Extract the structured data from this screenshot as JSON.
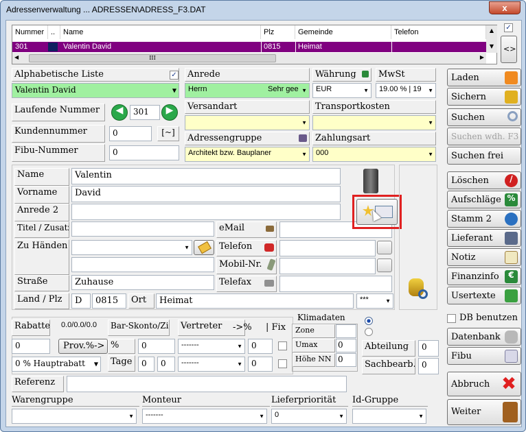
{
  "window": {
    "title": "Adressenverwaltung ... ADRESSEN\\ADRESS_F3.DAT",
    "close": "x"
  },
  "grid": {
    "headers": {
      "nummer": "Nummer",
      "dots": "..",
      "name": "Name",
      "plz": "Plz",
      "gemeinde": "Gemeinde",
      "telefon": "Telefon"
    },
    "row": {
      "nummer": "301",
      "name": "Valentin David",
      "plz": "0815",
      "gemeinde": "Heimat"
    },
    "hthumb": "III"
  },
  "nav": "<>",
  "alpha": {
    "label": "Alphabetische Liste",
    "value": "Valentin David",
    "checked": "✓"
  },
  "anrede": {
    "label": "Anrede",
    "value": "Herrn",
    "value2": "Sehr gee"
  },
  "waehrung": {
    "label": "Währung",
    "value": "EUR"
  },
  "mwst": {
    "label": "MwSt",
    "value": "19.00 % | 19"
  },
  "laufende": {
    "label": "Laufende Nummer",
    "value": "301"
  },
  "versandart": {
    "label": "Versandart"
  },
  "transport": {
    "label": "Transportkosten"
  },
  "kundennummer": {
    "label": "Kundennummer",
    "value": "0",
    "btn": "[~]"
  },
  "adressgruppe": {
    "label": "Adressengruppe",
    "value": "Architekt bzw. Bauplaner"
  },
  "zahlungsart": {
    "label": "Zahlungsart",
    "value": "000"
  },
  "fibu_nr": {
    "label": "Fibu-Nummer",
    "value": "0"
  },
  "addr": {
    "name_label": "Name",
    "name": "Valentin",
    "vorname_label": "Vorname",
    "vorname": "David",
    "anrede2_label": "Anrede 2",
    "titel_label": "Titel / Zusatz",
    "zuhanden_label": "Zu Händen",
    "strasse_label": "Straße",
    "strasse": "Zuhause",
    "land_label": "Land / Plz",
    "land": "D",
    "plz": "0815",
    "ort_label": "Ort",
    "ort": "Heimat",
    "ort_dd": "***"
  },
  "contact": {
    "email": "eMail",
    "telefon": "Telefon",
    "mobil": "Mobil-Nr.",
    "telefax": "Telefax"
  },
  "cond": {
    "rabatte": "Rabatte",
    "rabatte_val": "0",
    "pct": "0.0/0.0/0.0",
    "provbtn": "Prov.%->",
    "haupt": "0 % Hauptrabatt",
    "skonto": "Bar-Skonto/Ziel",
    "pctsym": "%",
    "skonto_val": "0",
    "tage": "Tage",
    "tage1": "0",
    "tage2": "0",
    "vertreter": "Vertreter",
    "arrow": "->%",
    "fix": "| Fix",
    "v1": "-------",
    "v1n": "0",
    "v2": "-------",
    "v2n": "0"
  },
  "klima": {
    "label": "Klimadaten",
    "zone": "Zone",
    "umax": "Umax",
    "umax_val": "0",
    "hoehe": "Höhe NN",
    "hoehe_val": "0"
  },
  "abteilung": {
    "label": "Abteilung",
    "value": "0"
  },
  "sachbearb": {
    "label": "Sachbearb.",
    "value": "0"
  },
  "referenz": {
    "label": "Referenz"
  },
  "warengruppe": {
    "label": "Warengruppe"
  },
  "monteur": {
    "label": "Monteur",
    "value": "-------"
  },
  "lieferprio": {
    "label": "Lieferpriorität",
    "value": "0"
  },
  "idgruppe": {
    "label": "Id-Gruppe"
  },
  "buttons": {
    "laden": "Laden",
    "sichern": "Sichern",
    "suchen": "Suchen",
    "suchen_wdh": "Suchen wdh. F3",
    "suchen_frei": "Suchen frei",
    "loeschen": "Löschen",
    "aufschlaege": "Aufschläge",
    "stamm2": "Stamm 2",
    "lieferant": "Lieferant",
    "notiz": "Notiz",
    "finanzinfo": "Finanzinfo",
    "usertexte": "Usertexte",
    "db_benutzen": "DB benutzen",
    "datenbank": "Datenbank",
    "fibu": "Fibu",
    "abbruch": "Abbruch",
    "weiter": "Weiter"
  },
  "colors": {
    "selection": "#800080",
    "green_field": "#a0f0a0",
    "yellow_field": "#ffffc8",
    "highlight": "#e02020"
  }
}
